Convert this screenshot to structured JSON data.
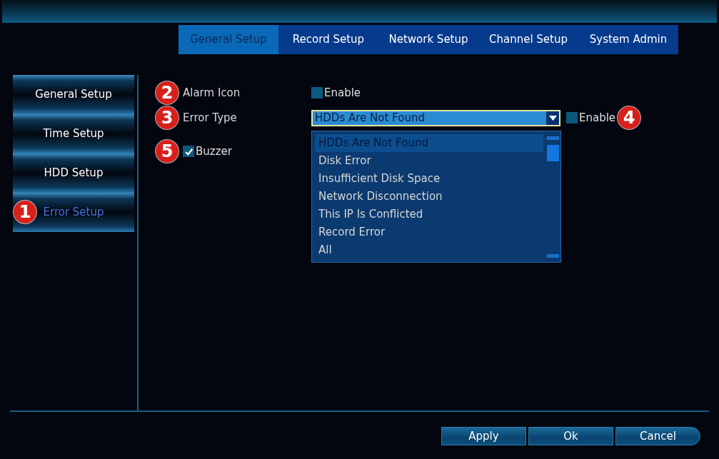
{
  "tabs": [
    {
      "label": "General Setup",
      "selected": true
    },
    {
      "label": "Record Setup",
      "selected": false
    },
    {
      "label": "Network Setup",
      "selected": false
    },
    {
      "label": "Channel Setup",
      "selected": false
    },
    {
      "label": "System Admin",
      "selected": false
    }
  ],
  "sidebar": {
    "items": [
      {
        "label": "General Setup",
        "selected": false
      },
      {
        "label": "Time Setup",
        "selected": false
      },
      {
        "label": "HDD Setup",
        "selected": false
      },
      {
        "label": "Error Setup",
        "selected": true,
        "callout": "1"
      }
    ]
  },
  "form": {
    "alarm_icon": {
      "callout": "2",
      "label": "Alarm Icon",
      "checkbox_label": "Enable",
      "checked": false
    },
    "error_type": {
      "callout": "3",
      "label": "Error Type",
      "value": "HDDs Are Not Found",
      "enable_label": "Enable",
      "enable_checked": false,
      "enable_callout": "4",
      "options": [
        {
          "label": "HDDs Are Not Found",
          "selected": true
        },
        {
          "label": "Disk Error",
          "selected": false
        },
        {
          "label": "Insufficient Disk Space",
          "selected": false
        },
        {
          "label": "Network Disconnection",
          "selected": false
        },
        {
          "label": "This IP Is Conflicted",
          "selected": false
        },
        {
          "label": "Record Error",
          "selected": false
        },
        {
          "label": "All",
          "selected": false
        }
      ]
    },
    "buzzer": {
      "callout": "5",
      "label": "Buzzer",
      "checked": true
    }
  },
  "buttons": [
    "Apply",
    "Ok",
    "Cancel"
  ]
}
